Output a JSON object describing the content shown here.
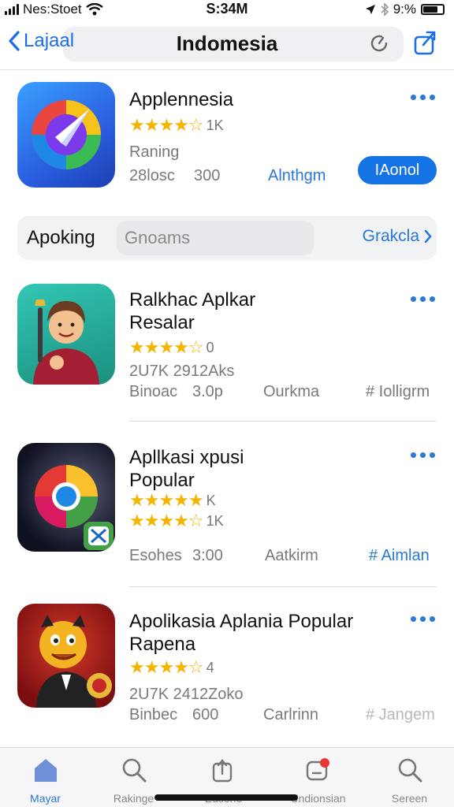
{
  "status": {
    "carrier": "Nes:Stoet",
    "time": "S:34M",
    "battery": "9:%"
  },
  "nav": {
    "back_label": "Lajaal",
    "title": "Indomesia",
    "icons": {
      "back": "chevron-left-icon",
      "refresh": "refresh-icon",
      "share": "share-icon"
    }
  },
  "featured": {
    "name": "Applennesia",
    "stars": "★★★★☆",
    "rating_count": "1K",
    "label": "Raning",
    "size": "28losc",
    "price": "300",
    "developer": "Alnthgm",
    "button": "IAonol"
  },
  "segment": {
    "left": "Apoking",
    "middle": "Gnoams",
    "right": "Grakcla"
  },
  "apps": [
    {
      "name_line1": "Ralkhac Aplkar",
      "name_line2": "Resalar",
      "stars1": "★★★★☆",
      "count1": "0",
      "downloads": "2U7K 2912Aks",
      "size": "Binoac",
      "price": "3.0p",
      "category": "Ourkma",
      "tag": "# Iolligrm"
    },
    {
      "name_line1": "Apllkasi xpusi",
      "name_line2": "Popular",
      "stars1": "★★★★★",
      "count1": "K",
      "stars2": "★★★★☆",
      "count2": "1K",
      "size": "Esohes",
      "price": "3:00",
      "category": "Aatkirm",
      "tag": "# Aimlan"
    },
    {
      "name_line1": "Apolikasia Aplania Popular",
      "name_line2": "Rapena",
      "stars1": "★★★★☆",
      "count1": "4",
      "downloads": "2U7K 2412Zoko",
      "size": "Binbec",
      "price": "600",
      "category": "Carlrinn",
      "tag": "# Jangem"
    }
  ],
  "tabs": [
    {
      "label": "Mayar",
      "icon": "home-icon"
    },
    {
      "label": "Rakinge",
      "icon": "search-icon"
    },
    {
      "label": "Eusone",
      "icon": "upload-icon"
    },
    {
      "label": "Undionsian",
      "icon": "notification-icon"
    },
    {
      "label": "Sereen",
      "icon": "search-icon"
    }
  ],
  "colors": {
    "accent": "#1673e6",
    "link": "#2a78d8",
    "star": "#f4b400"
  }
}
